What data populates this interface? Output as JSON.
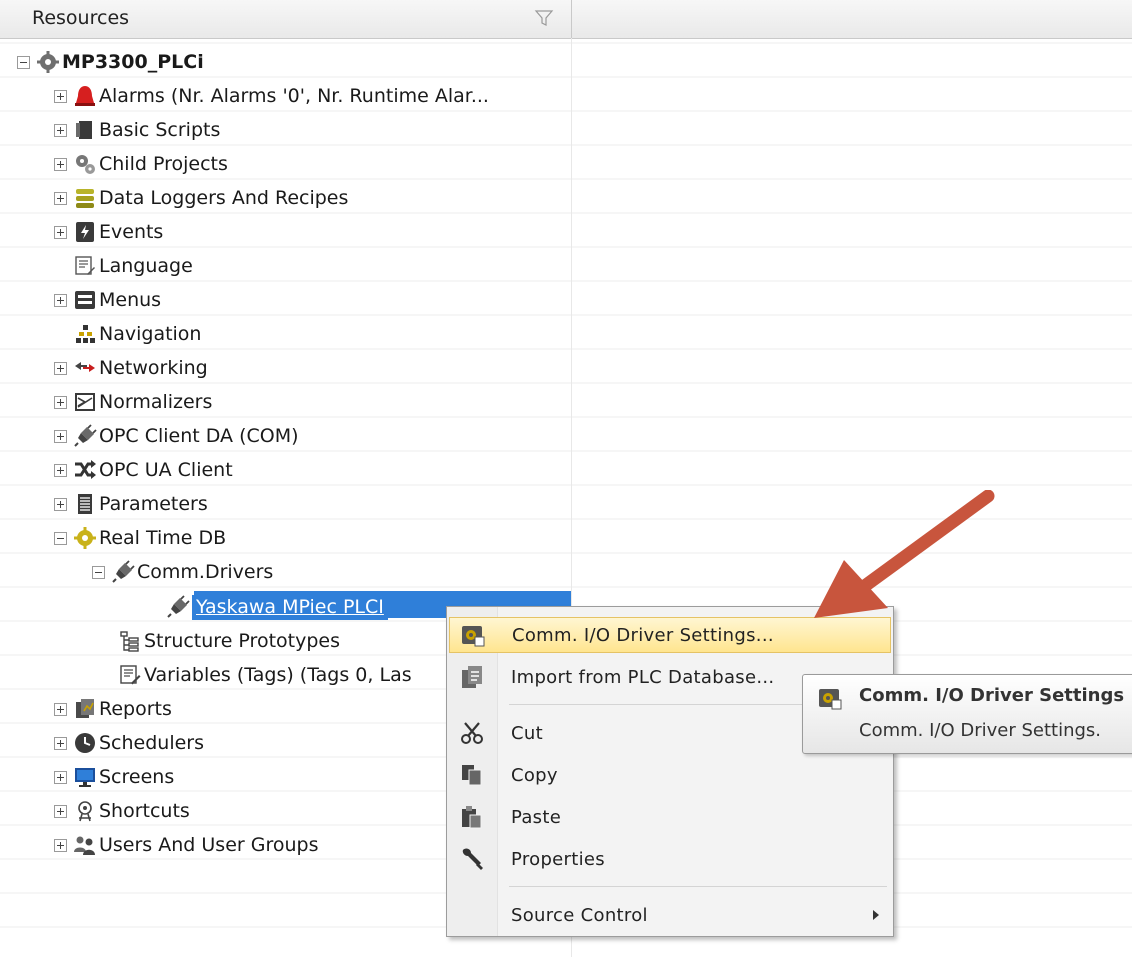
{
  "header": {
    "title": "Resources",
    "filter_icon": "filter-icon"
  },
  "tree": {
    "root": {
      "label": "MP3300_PLCi",
      "icon": "gear-icon"
    },
    "items": [
      {
        "label": "Alarms (Nr. Alarms '0', Nr. Runtime Alar...",
        "icon": "alarm-bell-icon"
      },
      {
        "label": "Basic Scripts",
        "icon": "script-icon"
      },
      {
        "label": "Child Projects",
        "icon": "gears-icon"
      },
      {
        "label": "Data Loggers And Recipes",
        "icon": "database-icon"
      },
      {
        "label": "Events",
        "icon": "events-icon"
      },
      {
        "label": "Language",
        "icon": "language-icon"
      },
      {
        "label": "Menus",
        "icon": "menu-icon"
      },
      {
        "label": "Navigation",
        "icon": "navigation-icon"
      },
      {
        "label": "Networking",
        "icon": "network-arrows-icon"
      },
      {
        "label": "Normalizers",
        "icon": "normalizer-icon"
      },
      {
        "label": "OPC Client DA (COM)",
        "icon": "plug-icon"
      },
      {
        "label": "OPC UA Client",
        "icon": "shuffle-icon"
      },
      {
        "label": "Parameters",
        "icon": "parameters-icon"
      },
      {
        "label": "Real Time DB",
        "icon": "gear-yellow-icon"
      },
      {
        "label": "Comm.Drivers",
        "icon": "plug-icon"
      },
      {
        "label": "Yaskawa MPiec PLCI",
        "icon": "plug-driver-icon"
      },
      {
        "label": "Structure Prototypes",
        "icon": "structure-icon"
      },
      {
        "label": "Variables (Tags) (Tags 0, Las",
        "icon": "variables-icon"
      },
      {
        "label": "Reports",
        "icon": "reports-icon"
      },
      {
        "label": "Schedulers",
        "icon": "clock-icon"
      },
      {
        "label": "Screens",
        "icon": "monitor-icon"
      },
      {
        "label": "Shortcuts",
        "icon": "shortcuts-icon"
      },
      {
        "label": "Users And User Groups",
        "icon": "users-icon"
      }
    ]
  },
  "context_menu": {
    "items": [
      {
        "label": "Comm. I/O Driver Settings...",
        "icon": "driver-settings-icon",
        "highlighted": true
      },
      {
        "label": "Import from PLC Database...",
        "icon": "import-icon"
      },
      {
        "label": "Cut",
        "icon": "scissors-icon"
      },
      {
        "label": "Copy",
        "icon": "copy-icon"
      },
      {
        "label": "Paste",
        "icon": "paste-icon"
      },
      {
        "label": "Properties",
        "icon": "wrench-icon"
      },
      {
        "label": "Source Control",
        "icon": "",
        "submenu": true
      }
    ]
  },
  "tooltip": {
    "title": "Comm. I/O Driver Settings",
    "description": "Comm. I/O Driver Settings.",
    "icon": "driver-settings-icon"
  },
  "annotation": {
    "icon": "red-arrow-icon",
    "color": "#c8553d"
  },
  "colors": {
    "selection": "#2f7fd9",
    "menu_highlight": "#ffe58f",
    "arrow": "#c8553d"
  }
}
